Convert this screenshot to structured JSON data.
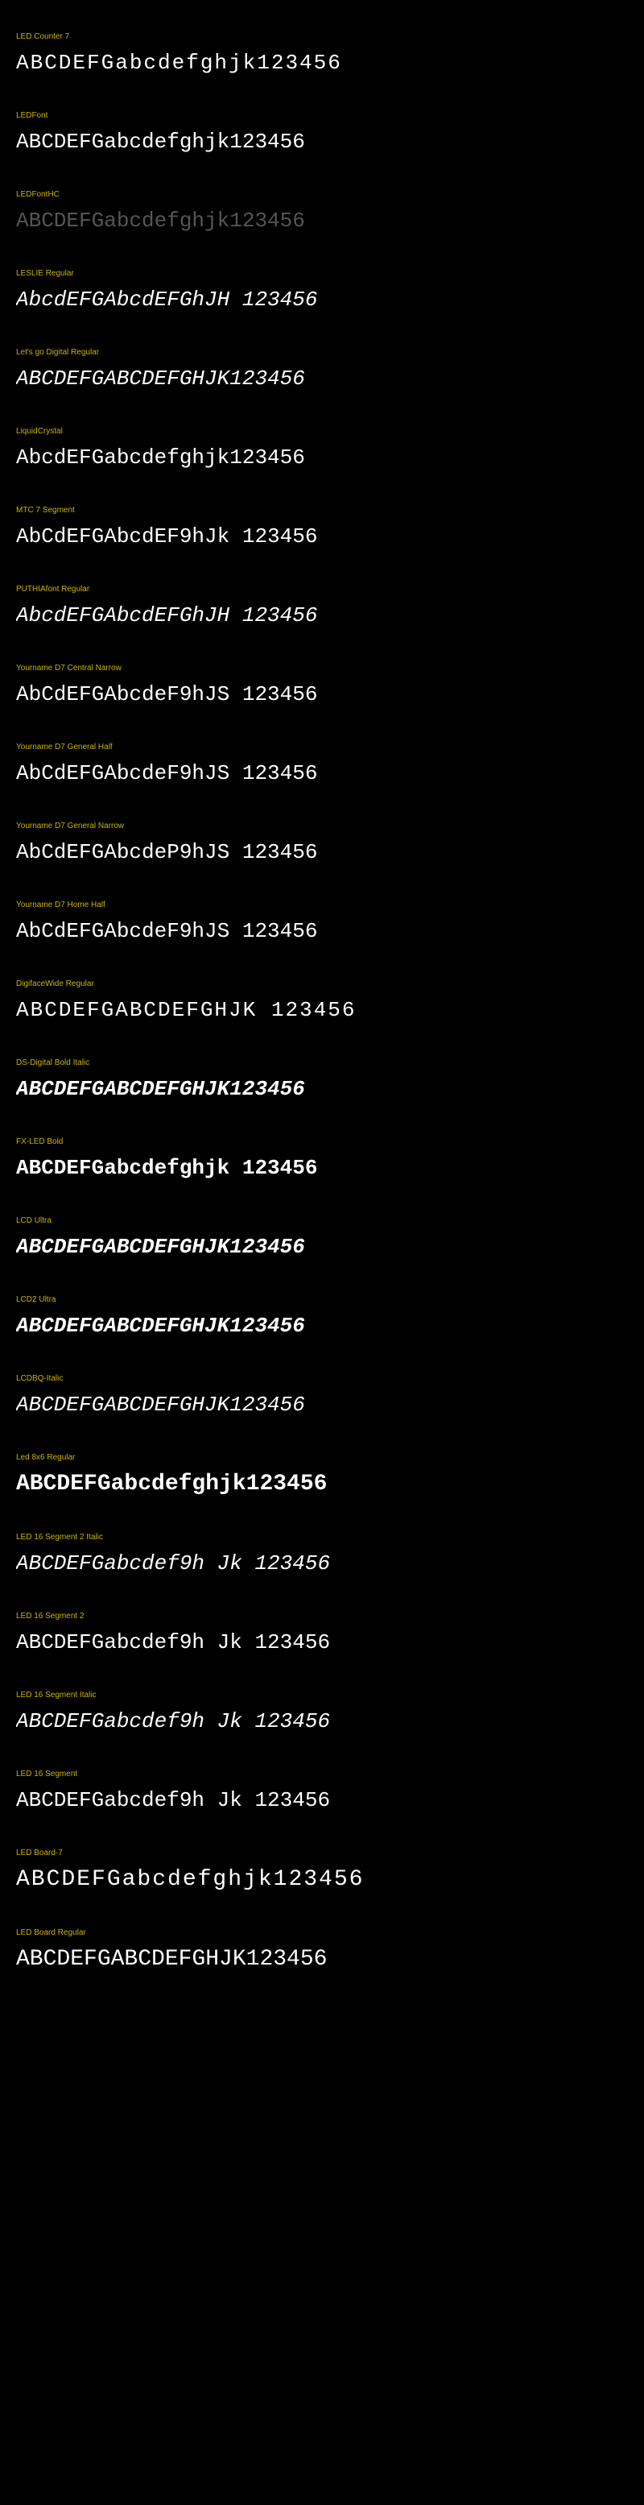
{
  "fonts": [
    {
      "name": "LED Counter 7",
      "sample": "ABCDEFGabcdefghjk123456",
      "classes": "wide"
    },
    {
      "name": "LEDFont",
      "sample": "ABCDEFGabcdefghjk123456",
      "classes": ""
    },
    {
      "name": "LEDFontHC",
      "sample": "ABCDEFGabcdefghjk123456",
      "classes": "faded"
    },
    {
      "name": "LESLIE Regular",
      "sample": "AbcdEFGAbcdEFGhJH 123456",
      "classes": "italic"
    },
    {
      "name": "Let's go Digital Regular",
      "sample": "ABCDEFGABCDEFGHJK123456",
      "classes": "italic"
    },
    {
      "name": "LiquidCrystal",
      "sample": "AbcdEFGabcdefghjk123456",
      "classes": ""
    },
    {
      "name": "MTC 7 Segment",
      "sample": "AbCdEFGAbcdEF9hJk 123456",
      "classes": ""
    },
    {
      "name": "PUTHIAfont Regular",
      "sample": "AbcdEFGAbcdEFGhJH 123456",
      "classes": "italic"
    },
    {
      "name": "Yourname D7 Central Narrow",
      "sample": "AbCdEFGAbcdeF9hJS 123456",
      "classes": ""
    },
    {
      "name": "Yourname D7 General Half",
      "sample": "AbCdEFGAbcdeF9hJS 123456",
      "classes": ""
    },
    {
      "name": "Yourname D7 General Narrow",
      "sample": "AbCdEFGAbcdeP9hJS 123456",
      "classes": ""
    },
    {
      "name": "Yourname D7 Home Half",
      "sample": "AbCdEFGAbcdeF9hJS 123456",
      "classes": ""
    },
    {
      "name": "DigifaceWide Regular",
      "sample": "ABCDEFGABCDEFGHJK 123456",
      "classes": "wide"
    },
    {
      "name": "DS-Digital Bold Italic",
      "sample": "ABCDEFGABCDEFGHJK123456",
      "classes": "italic bold"
    },
    {
      "name": "FX-LED Bold",
      "sample": "ABCDEFGabcdefghjk 123456",
      "classes": "bold"
    },
    {
      "name": "LCD Ultra",
      "sample": "ABCDEFGABCDEFGHJK123456",
      "classes": "italic bold"
    },
    {
      "name": "LCD2 Ultra",
      "sample": "ABCDEFGABCDEFGHJK123456",
      "classes": "italic bold"
    },
    {
      "name": "LCDBQ-Italic",
      "sample": "ABCDEFGABCDEFGHJK123456",
      "classes": "italic"
    },
    {
      "name": "Led 8x6 Regular",
      "sample": "ABCDEFGabcdefghjk123456",
      "classes": "bold large"
    },
    {
      "name": "LED 16 Segment 2 Italic",
      "sample": "ABCDEFGabcdef9h Jk 123456",
      "classes": "italic"
    },
    {
      "name": "LED 16 Segment 2",
      "sample": "ABCDEFGabcdef9h Jk 123456",
      "classes": ""
    },
    {
      "name": "LED 16 Segment Italic",
      "sample": "ABCDEFGabcdef9h Jk 123456",
      "classes": "italic"
    },
    {
      "name": "LED 16 Segment",
      "sample": "ABCDEFGabcdef9h Jk 123456",
      "classes": ""
    },
    {
      "name": "LED Board-7",
      "sample": "ABCDEFGabcdefghjk123456",
      "classes": "large wide"
    },
    {
      "name": "LED Board Regular",
      "sample": "ABCDEFGABCDEFGHJK123456",
      "classes": "large"
    }
  ]
}
